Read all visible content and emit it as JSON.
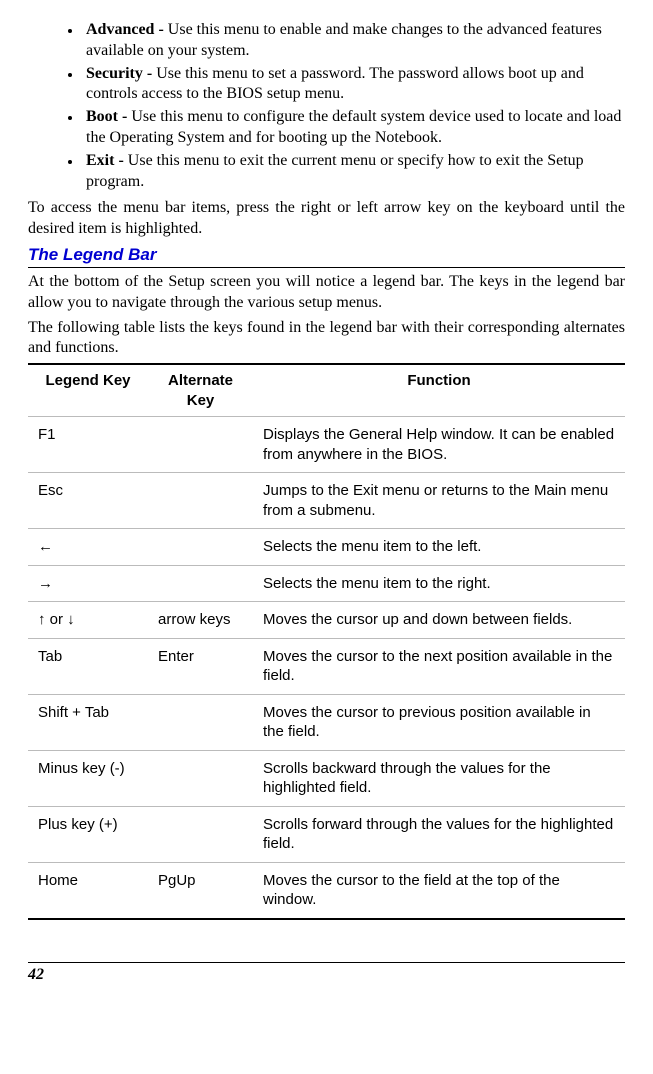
{
  "bullets": [
    {
      "name": "Advanced - ",
      "desc": "Use this menu to enable and make changes to the advanced features available on your system."
    },
    {
      "name": "Security - ",
      "desc": "Use this menu to set a password.  The password allows boot up and controls access to the BIOS setup menu."
    },
    {
      "name": "Boot - ",
      "desc": "Use this menu to configure the default system device used to locate and load the Operating System and for booting up the Notebook."
    },
    {
      "name": "Exit - ",
      "desc": "Use this menu to exit the current menu or specify how to exit the Setup program."
    }
  ],
  "para1": "To access the menu bar items, press the right or left arrow key on the keyboard until the desired item is highlighted.",
  "section_title": "The Legend Bar",
  "para2": "At the bottom of the Setup screen you will notice a legend bar.  The keys in the legend bar allow you to navigate through the various setup menus.",
  "para3": "The following table lists the keys found in the legend bar with their corresponding alternates and functions.",
  "table": {
    "headers": {
      "c1": "Legend Key",
      "c2": "Alternate Key",
      "c3": "Function"
    },
    "rows": [
      {
        "key": "F1",
        "alt": "",
        "fn": "Displays the General Help window.  It can be enabled from anywhere in the BIOS."
      },
      {
        "key": "Esc",
        "alt": "",
        "fn": "Jumps to the Exit menu or returns to the Main menu from a submenu."
      },
      {
        "key": "←",
        "alt": "",
        "fn": "Selects the menu item to the left."
      },
      {
        "key": "→",
        "alt": "",
        "fn": "Selects the menu item to the right."
      },
      {
        "key": "↑ or ↓",
        "alt": "arrow keys",
        "fn": "Moves the cursor up and down between fields."
      },
      {
        "key": "Tab",
        "alt": "Enter",
        "fn": "Moves the cursor to the next position available in the field."
      },
      {
        "key": "Shift + Tab",
        "alt": "",
        "fn": "Moves the cursor to previous position available in the field."
      },
      {
        "key": "Minus key (-)",
        "alt": "",
        "fn": "Scrolls backward through the values for the highlighted field."
      },
      {
        "key": "Plus key (+)",
        "alt": "",
        "fn": "Scrolls forward through the values for the highlighted field."
      },
      {
        "key": "Home",
        "alt": "PgUp",
        "fn": "Moves the cursor to the field at the top of the window."
      }
    ]
  },
  "page_number": "42"
}
